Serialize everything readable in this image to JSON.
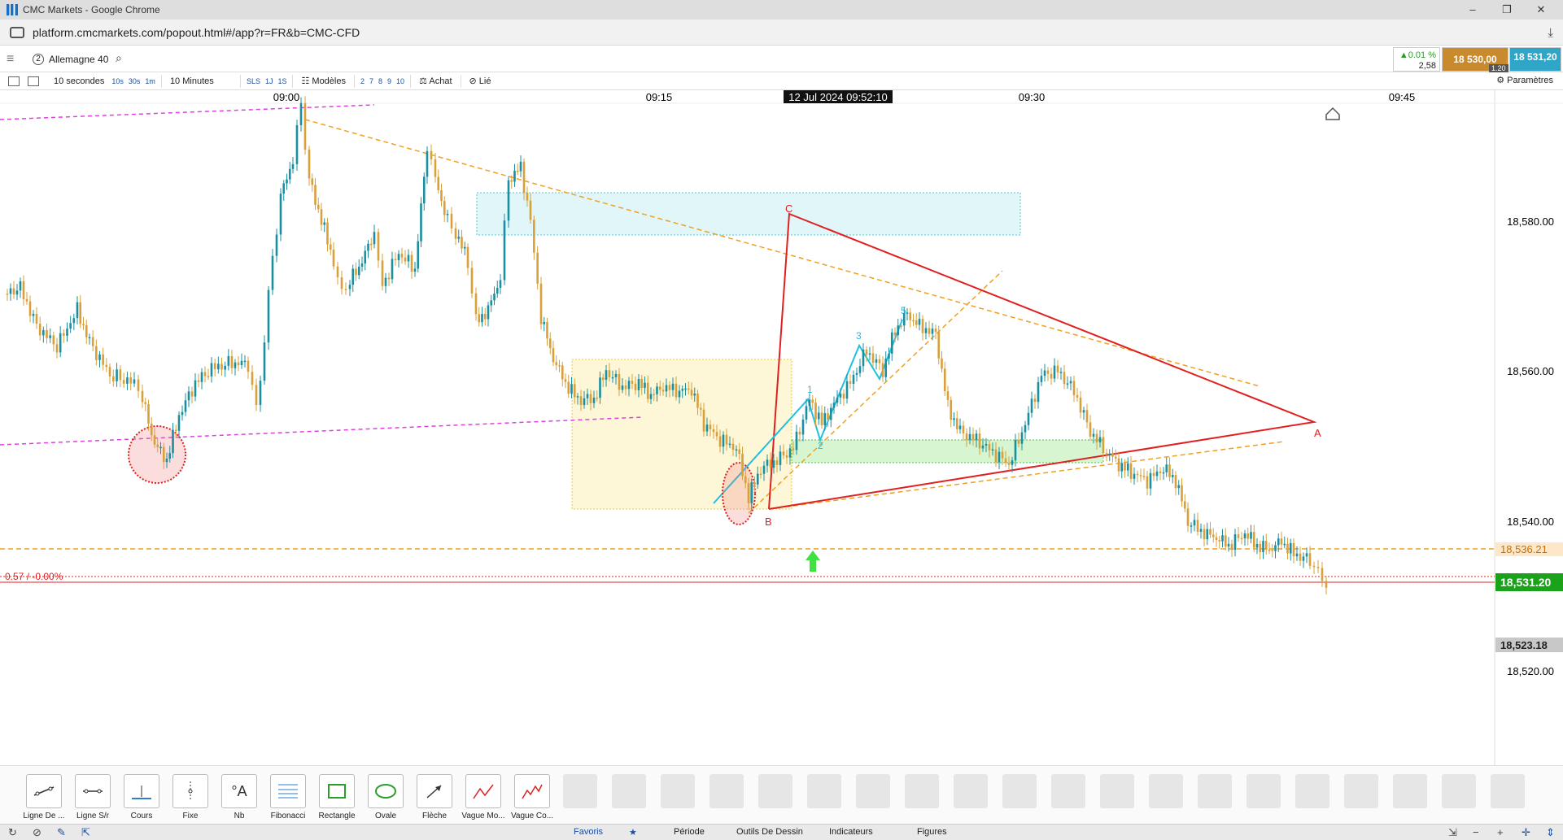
{
  "window": {
    "title": "CMC Markets - Google Chrome",
    "url": "platform.cmcmarkets.com/popout.html#/app?r=FR&b=CMC-CFD"
  },
  "header": {
    "badge": "2",
    "instrument": "Allemagne 40",
    "change_pct": "▲0.01 %",
    "change_pts": "2,58",
    "sell": "18 530,00",
    "buy": "18 531,20",
    "spread": "1.20"
  },
  "toolbar": {
    "interval": "10 secondes",
    "quick_intervals": [
      "10s",
      "30s",
      "1m"
    ],
    "range": "10 Minutes",
    "quick_ranges": [
      "SLS",
      "1J",
      "1S"
    ],
    "templates": "Modèles",
    "numbers": [
      "2",
      "7",
      "8",
      "9",
      "10"
    ],
    "buy_label": "Achat",
    "link_label": "Lié",
    "settings": "Paramètres"
  },
  "chart": {
    "time_labels": [
      "09:00",
      "09:15",
      "12 Jul 2024 09:52:10",
      "09:30",
      "09:45"
    ],
    "price_labels": [
      "18,580.00",
      "18,560.00",
      "18,540.00",
      "18,520.00"
    ],
    "level_label": "18,536.21",
    "current_price": "18,531.20",
    "low_price": "18,523.18",
    "pct_label": "0.57 / -0.00%",
    "point_labels": [
      "A",
      "B",
      "C"
    ],
    "wave_labels": [
      "1",
      "2",
      "3",
      "5"
    ],
    "colors": {
      "up": "#1a8fa0",
      "down": "#d9a03a",
      "red": "#e02020",
      "orange": "#f0a020",
      "magenta": "#e040e0",
      "cyan": "#20c0e0"
    }
  },
  "tools": [
    {
      "label": "Ligne De ..."
    },
    {
      "label": "Ligne S/r"
    },
    {
      "label": "Cours"
    },
    {
      "label": "Fixe"
    },
    {
      "label": "Nb"
    },
    {
      "label": "Fibonacci"
    },
    {
      "label": "Rectangle"
    },
    {
      "label": "Ovale"
    },
    {
      "label": "Flèche"
    },
    {
      "label": "Vague Mo..."
    },
    {
      "label": "Vague Co..."
    }
  ],
  "tabs": [
    "Favoris",
    "Période",
    "Outils De Dessin",
    "Indicateurs",
    "Figures"
  ]
}
